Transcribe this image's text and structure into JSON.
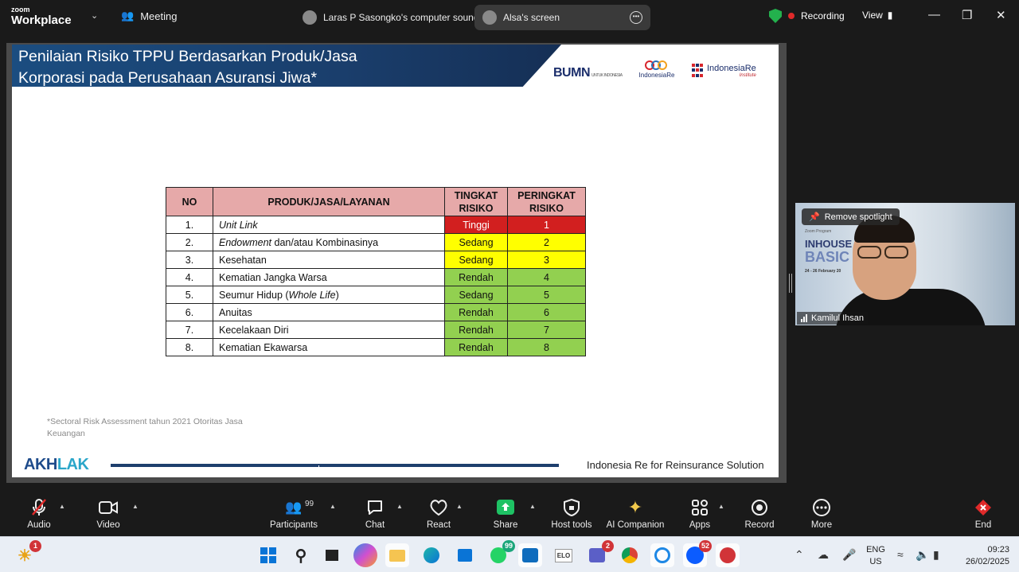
{
  "topbar": {
    "logo_line1": "zoom",
    "logo_line2": "Workplace",
    "meeting_label": "Meeting",
    "sound_label": "Laras P Sasongko's computer sound",
    "screen_label": "Alsa's screen",
    "recording_label": "Recording",
    "view_label": "View"
  },
  "slide": {
    "title_line1": "Penilaian Risiko TPPU Berdasarkan Produk/Jasa",
    "title_line2": "Korporasi pada Perusahaan Asuransi Jiwa*",
    "logo_bumn": "BUMN",
    "logo_bumn_sub": "UNTUK INDONESIA",
    "logo_indonesiare": "IndonesiaRe",
    "logo_iri": "IndonesiaRe",
    "logo_iri_sub": "Institute",
    "table": {
      "headers": [
        "NO",
        "PRODUK/JASA/LAYANAN",
        "TINGKAT RISIKO",
        "PERINGKAT RISIKO"
      ],
      "rows": [
        {
          "no": "1.",
          "prod_italic": "Unit Link",
          "prod_rest": "",
          "prod_italic2": "",
          "prod_tail": "",
          "level": "Tinggi",
          "rank": "1",
          "color": "#d21f1f",
          "text_color": "#ffffff"
        },
        {
          "no": "2.",
          "prod_italic": "Endowment",
          "prod_rest": " dan/atau Kombinasinya",
          "prod_italic2": "",
          "prod_tail": "",
          "level": "Sedang",
          "rank": "2",
          "color": "#ffff00",
          "text_color": "#111111"
        },
        {
          "no": "3.",
          "prod_italic": "",
          "prod_rest": "Kesehatan",
          "prod_italic2": "",
          "prod_tail": "",
          "level": "Sedang",
          "rank": "3",
          "color": "#ffff00",
          "text_color": "#111111"
        },
        {
          "no": "4.",
          "prod_italic": "",
          "prod_rest": "Kematian Jangka Warsa",
          "prod_italic2": "",
          "prod_tail": "",
          "level": "Rendah",
          "rank": "4",
          "color": "#92d050",
          "text_color": "#111111"
        },
        {
          "no": "5.",
          "prod_italic": "",
          "prod_rest": "Seumur Hidup (",
          "prod_italic2": "Whole Life",
          "prod_tail": ")",
          "level": "Sedang",
          "rank": "5",
          "color": "#92d050",
          "text_color": "#111111"
        },
        {
          "no": "6.",
          "prod_italic": "",
          "prod_rest": "Anuitas",
          "prod_italic2": "",
          "prod_tail": "",
          "level": "Rendah",
          "rank": "6",
          "color": "#92d050",
          "text_color": "#111111"
        },
        {
          "no": "7.",
          "prod_italic": "",
          "prod_rest": "Kecelakaan Diri",
          "prod_italic2": "",
          "prod_tail": "",
          "level": "Rendah",
          "rank": "7",
          "color": "#92d050",
          "text_color": "#111111"
        },
        {
          "no": "8.",
          "prod_italic": "",
          "prod_rest": "Kematian Ekawarsa",
          "prod_italic2": "",
          "prod_tail": "",
          "level": "Rendah",
          "rank": "8",
          "color": "#92d050",
          "text_color": "#111111"
        }
      ]
    },
    "footnote": "*Sectoral Risk Assessment  tahun 2021 Otoritas Jasa Keuangan",
    "akhlak_a": "AKH",
    "akhlak_b": "LAK",
    "footer_text": "Indonesia Re for Reinsurance Solution"
  },
  "video": {
    "remove_spotlight": "Remove spotlight",
    "participant_name": "Kamilul Ihsan",
    "banner_small": "Zoom Program",
    "banner_line1": "INHOUSE",
    "banner_line2": "BASIC",
    "banner_date": "24 - 26 February 20"
  },
  "controls": {
    "audio": "Audio",
    "video": "Video",
    "participants": "Participants",
    "participants_count": "99",
    "chat": "Chat",
    "react": "React",
    "share": "Share",
    "host_tools": "Host tools",
    "ai_companion": "AI Companion",
    "apps": "Apps",
    "record": "Record",
    "more": "More",
    "end": "End"
  },
  "taskbar": {
    "weather_badge": "1",
    "whatsapp_badge": "99",
    "teams_badge": "2",
    "zoom_badge": "52",
    "elo_label": "ELO",
    "lang_line1": "ENG",
    "lang_line2": "US",
    "time": "09:23",
    "date": "26/02/2025"
  }
}
